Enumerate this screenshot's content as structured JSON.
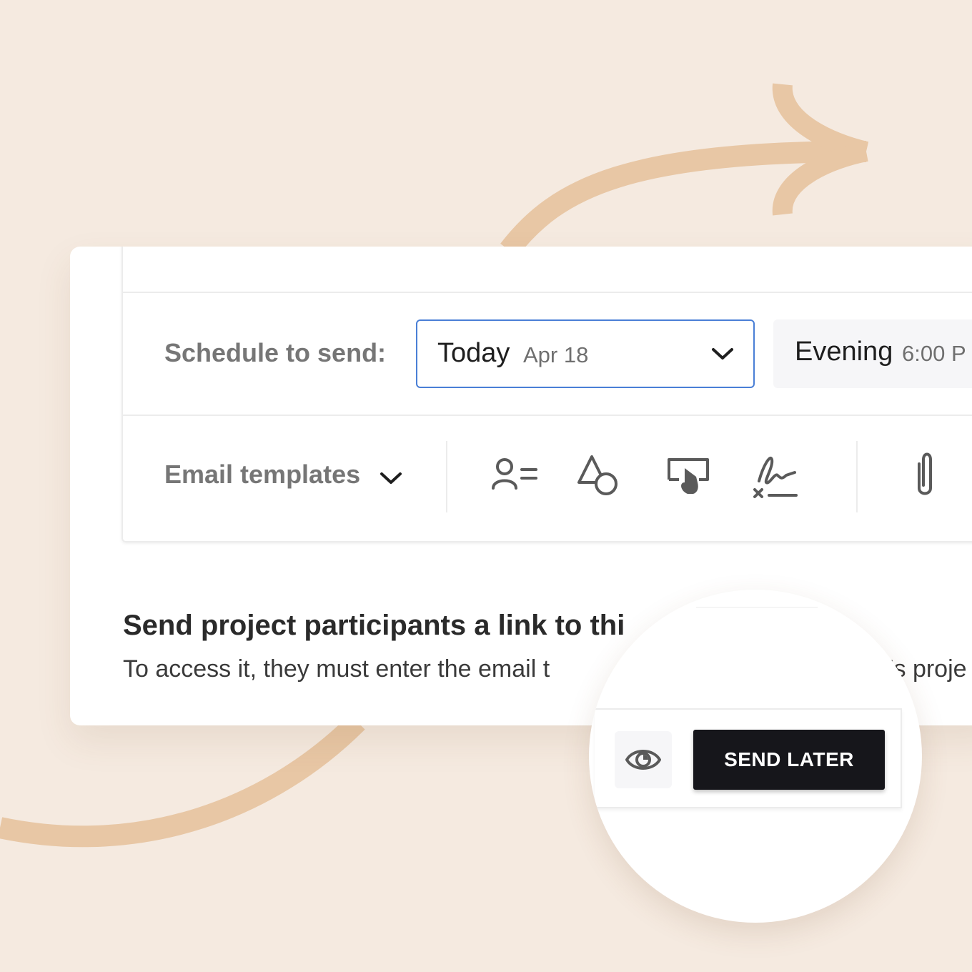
{
  "schedule": {
    "label": "Schedule to send:",
    "date_option": "Today",
    "date_value": "Apr 18",
    "time_option": "Evening",
    "time_value": "6:00 P"
  },
  "toolbar": {
    "templates_label": "Email templates",
    "icons": [
      "contact-list-icon",
      "shapes-icon",
      "screen-tap-icon",
      "signature-icon",
      "paperclip-icon"
    ]
  },
  "content": {
    "title": "Send project participants a link to thi",
    "description_start": "To access it, they must enter the email t",
    "description_end": "'s proje"
  },
  "actions": {
    "preview_icon": "eye-icon",
    "send_later_label": "SEND LATER"
  },
  "colors": {
    "background": "#f5eae0",
    "arrow": "#e8c7a5",
    "focus_border": "#4a7fd6",
    "primary_button": "#16161b"
  }
}
